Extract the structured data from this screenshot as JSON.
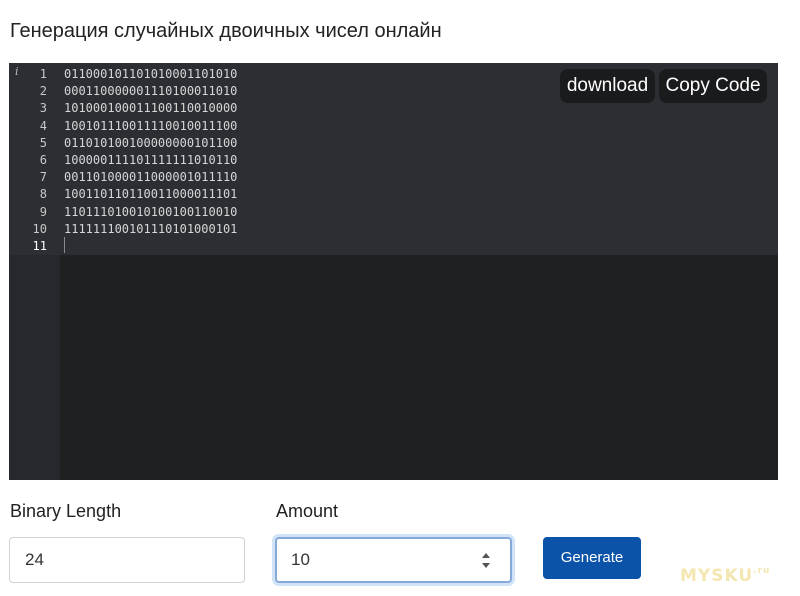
{
  "page": {
    "title": "Генерация случайных двоичных чисел онлайн"
  },
  "editor": {
    "info_glyph": "i",
    "lines": [
      {
        "num": "1",
        "code": "011000101101010001101010"
      },
      {
        "num": "2",
        "code": "000110000001110100011010"
      },
      {
        "num": "3",
        "code": "101000100011100110010000"
      },
      {
        "num": "4",
        "code": "100101110011110010011100"
      },
      {
        "num": "5",
        "code": "011010100100000000101100"
      },
      {
        "num": "6",
        "code": "100000111101111111010110"
      },
      {
        "num": "7",
        "code": "001101000011000001011110"
      },
      {
        "num": "8",
        "code": "100110110110011000011101"
      },
      {
        "num": "9",
        "code": "110111010010100100110010"
      },
      {
        "num": "10",
        "code": "111111100101110101000101"
      },
      {
        "num": "11",
        "code": ""
      }
    ],
    "download_label": "download",
    "copy_label": "Copy Code"
  },
  "form": {
    "length_label": "Binary Length",
    "length_value": "24",
    "amount_label": "Amount",
    "amount_value": "10",
    "generate_label": "Generate"
  },
  "watermark": {
    "text": "MYSKU",
    "suffix": ".ru"
  },
  "colors": {
    "editor_bg": "#1e2022",
    "accent": "#0b53a8"
  }
}
